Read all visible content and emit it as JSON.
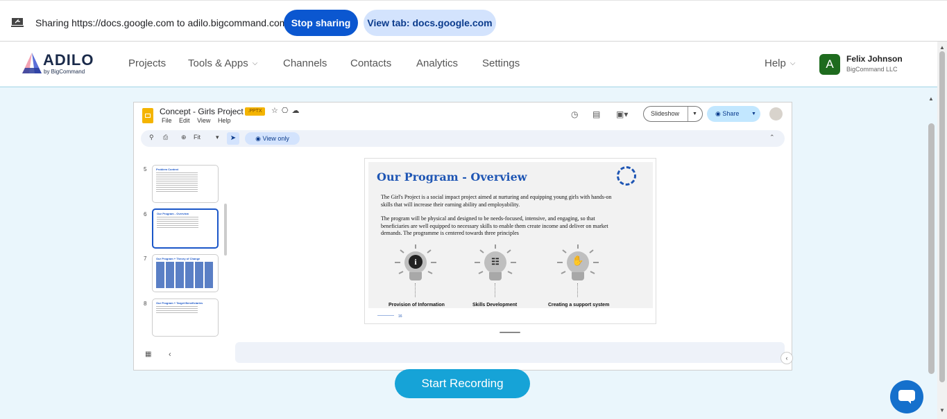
{
  "share_bar": {
    "text": "Sharing https://docs.google.com to adilo.bigcommand.com",
    "stop_label": "Stop sharing",
    "view_tab_label": "View tab: docs.google.com"
  },
  "header": {
    "logo_word": "ADILO",
    "logo_sub": "by BigCommand",
    "nav": [
      "Projects",
      "Tools & Apps",
      "Channels",
      "Contacts",
      "Analytics",
      "Settings"
    ],
    "help": "Help",
    "user": {
      "initial": "A",
      "name": "Felix Johnson",
      "org": "BigCommand LLC"
    }
  },
  "slides_app": {
    "doc_title": "Concept - Girls Project",
    "badge": ".PPTX",
    "menu": [
      "File",
      "Edit",
      "View",
      "Help"
    ],
    "slideshow_label": "Slideshow",
    "share_label": "Share",
    "zoom": "Fit",
    "view_only": "View only",
    "thumbnails": [
      {
        "num": "5",
        "title": "Problem Context"
      },
      {
        "num": "6",
        "title": "Our Program - Overview"
      },
      {
        "num": "7",
        "title": "Our Program + Theory of Change"
      },
      {
        "num": "8",
        "title": "Our Program + Target Beneficiaries"
      }
    ],
    "slide": {
      "title": "Our Program - Overview",
      "para1": "The Girl's Project is a social impact project aimed at nurturing and equipping young girls with hands-on skills that will increase their earning ability and employability.",
      "para2": "The program will be physical and designed to be needs-focused, intensive, and engaging, so that beneficiaries are well equipped to necessary skills to enable them create income and deliver on market demands. The programme is centered towards three principles",
      "principles": [
        "Provision of Information",
        "Skills Development",
        "Creating a support system"
      ],
      "page_num": "16"
    }
  },
  "record_label": "Start Recording",
  "colors": {
    "brand": "#16a3d7",
    "chrome_blue": "#0b57d0",
    "slide_title": "#1f56b4"
  }
}
